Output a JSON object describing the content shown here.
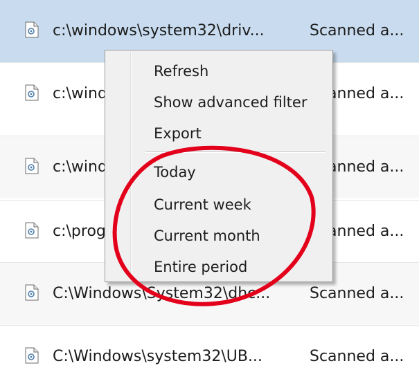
{
  "list": {
    "rows": [
      {
        "path": "c:\\windows\\system32\\driv...",
        "status": "Scanned a..."
      },
      {
        "path": "c:\\windows\\system32\\...",
        "status": "Scanned a..."
      },
      {
        "path": "c:\\windows\\system32\\...",
        "status": "Scanned a..."
      },
      {
        "path": "c:\\program files\\...",
        "status": "Scanned a..."
      },
      {
        "path": "C:\\Windows\\System32\\dhc...",
        "status": "Scanned a..."
      },
      {
        "path": "C:\\Windows\\system32\\UB...",
        "status": "Scanned a..."
      }
    ]
  },
  "context_menu": {
    "items": [
      "Refresh",
      "Show advanced filter",
      "Export",
      "Today",
      "Current week",
      "Current month",
      "Entire period"
    ]
  },
  "colors": {
    "selected_row": "#c9dcef",
    "annotation_circle": "#e3001b"
  },
  "icons": {
    "file": "document-file-icon"
  }
}
